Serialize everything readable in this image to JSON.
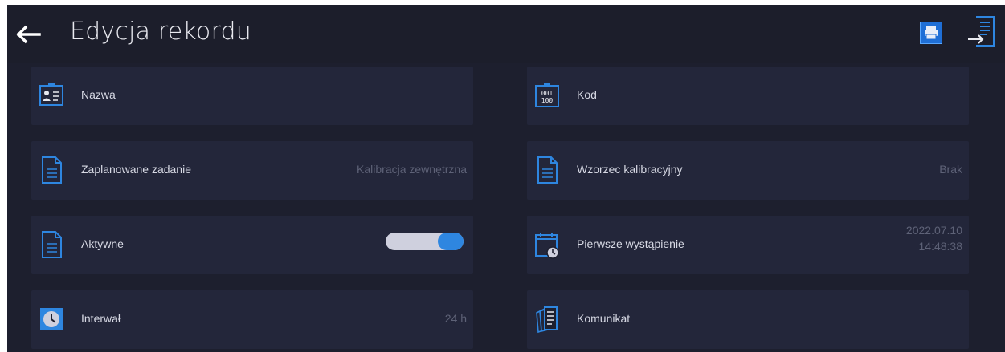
{
  "header": {
    "title": "Edycja rekordu",
    "back_icon": "arrow-left-icon",
    "print_icon": "printer-icon",
    "export_icon": "export-document-icon"
  },
  "tiles": {
    "nazwa": {
      "label": "Nazwa",
      "value": "",
      "icon": "id-card-icon"
    },
    "kod": {
      "label": "Kod",
      "value": "",
      "icon": "binary-code-icon"
    },
    "zadanie": {
      "label": "Zaplanowane zadanie",
      "value": "Kalibracja zewnętrzna",
      "icon": "document-icon"
    },
    "wzorzec": {
      "label": "Wzorzec kalibracyjny",
      "value": "Brak",
      "icon": "document-icon"
    },
    "aktywne": {
      "label": "Aktywne",
      "toggle_on": true,
      "icon": "document-icon"
    },
    "pierwsze": {
      "label": "Pierwsze wystąpienie",
      "date": "2022.07.10",
      "time": "14:48:38",
      "icon": "calendar-clock-icon"
    },
    "interwal": {
      "label": "Interwał",
      "value": "24 h",
      "icon": "clock-icon"
    },
    "komunikat": {
      "label": "Komunikat",
      "value": "",
      "icon": "message-documents-icon"
    }
  },
  "colors": {
    "background": "#1d1f2e",
    "tile": "#23263a",
    "accent": "#2e86e0",
    "toggle_track": "#cfd0de"
  }
}
